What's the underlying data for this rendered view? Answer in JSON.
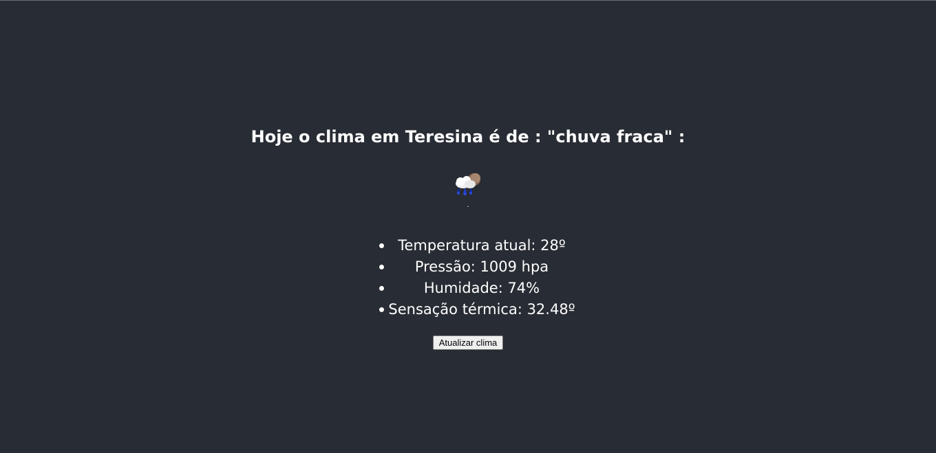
{
  "weather": {
    "title": "Hoje o clima em Teresina é de : \"chuva fraca\" :",
    "icon": "rain-cloud-moon-icon",
    "icon_caption": ".",
    "stats": [
      {
        "label": "Temperatura atual: 28º"
      },
      {
        "label": "Pressão: 1009 hpa"
      },
      {
        "label": "Humidade: 74%"
      },
      {
        "label": "Sensação térmica: 32.48º"
      }
    ],
    "refresh_label": "Atualizar clima"
  },
  "colors": {
    "background": "#282c34",
    "text": "#ffffff",
    "button_bg": "#efefef"
  }
}
